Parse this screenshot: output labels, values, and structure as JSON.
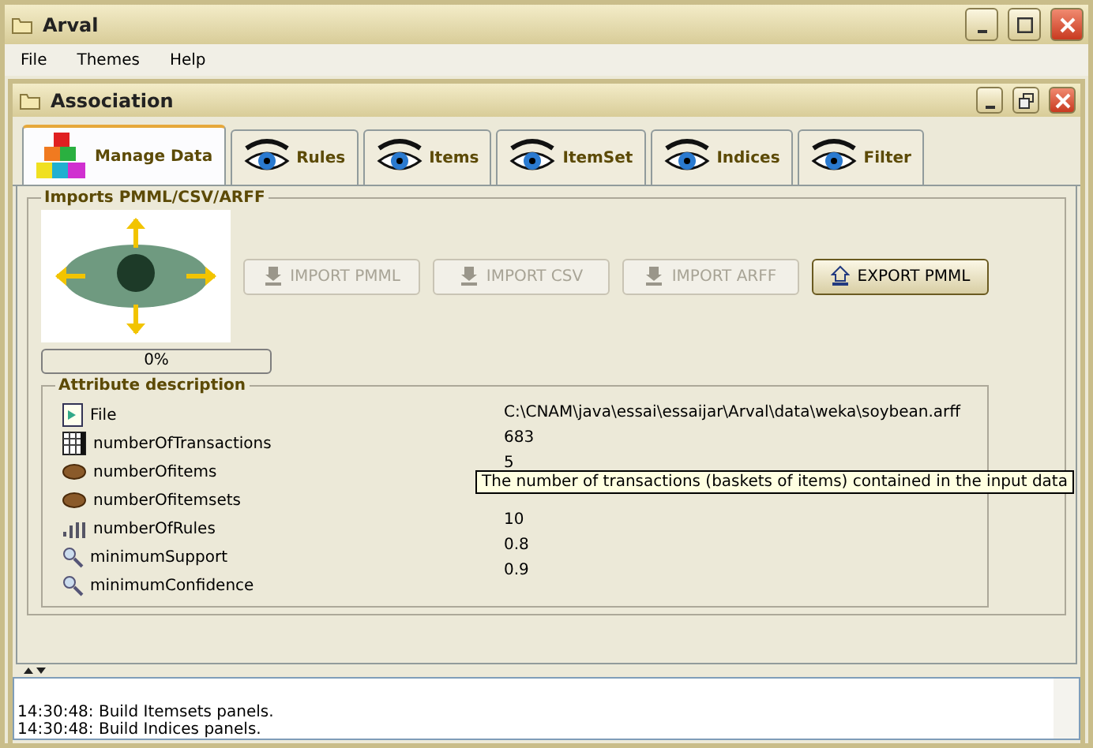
{
  "window": {
    "title": "Arval"
  },
  "menu": [
    "File",
    "Themes",
    "Help"
  ],
  "inner_window": {
    "title": "Association"
  },
  "tabs": [
    {
      "label": "Manage Data",
      "selected": true,
      "kind": "blocks"
    },
    {
      "label": "Rules",
      "selected": false,
      "kind": "eye"
    },
    {
      "label": "Items",
      "selected": false,
      "kind": "eye"
    },
    {
      "label": "ItemSet",
      "selected": false,
      "kind": "eye"
    },
    {
      "label": "Indices",
      "selected": false,
      "kind": "eye"
    },
    {
      "label": "Filter",
      "selected": false,
      "kind": "eye"
    }
  ],
  "imports": {
    "title": "Imports PMML/CSV/ARFF",
    "buttons": [
      {
        "label": "IMPORT PMML",
        "disabled": true,
        "kind": "import"
      },
      {
        "label": "IMPORT CSV",
        "disabled": true,
        "kind": "import"
      },
      {
        "label": "IMPORT ARFF",
        "disabled": true,
        "kind": "import"
      },
      {
        "label": "EXPORT PMML",
        "disabled": false,
        "kind": "export"
      }
    ],
    "progress": {
      "level": 0,
      "reading": "0%"
    }
  },
  "attributes": {
    "title": "Attribute description",
    "rows": [
      {
        "name": "File",
        "kind": "file"
      },
      {
        "name": "numberOfTransactions",
        "kind": "table"
      },
      {
        "name": "numberOfitems",
        "kind": "basket"
      },
      {
        "name": "numberOfitemsets",
        "kind": "basket"
      },
      {
        "name": "numberOfRules",
        "kind": "bars"
      },
      {
        "name": "minimumSupport",
        "kind": "tool"
      },
      {
        "name": "minimumConfidence",
        "kind": "tool"
      }
    ],
    "values": [
      "C:\\CNAM\\java\\essai\\essaijar\\Arval\\data\\weka\\soybean.arff",
      "683",
      "5",
      "10",
      "0.8",
      "0.9"
    ],
    "tooltip": "The number of transactions (baskets of items) contained in the input data"
  },
  "log": [
    "14:30:48: Build Itemsets panels.",
    "14:30:48: Build Indices panels."
  ]
}
